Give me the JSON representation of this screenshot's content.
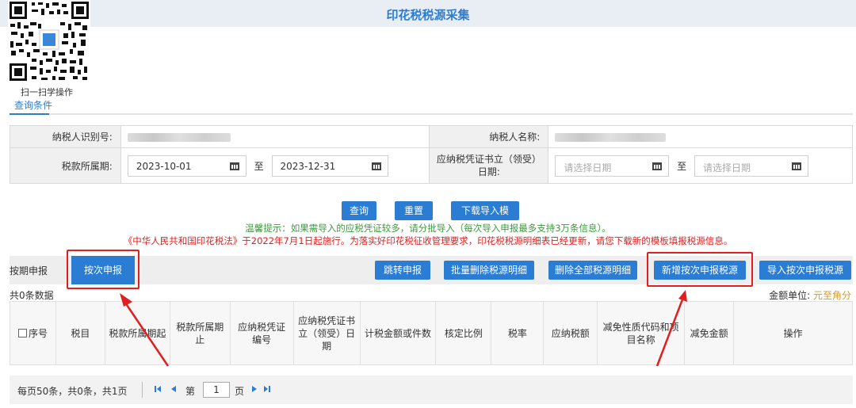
{
  "header": {
    "title": "印花税税源采集"
  },
  "qr": {
    "caption": "扫一扫学操作"
  },
  "query": {
    "section_title": "查询条件",
    "taxpayer_id_label": "纳税人识别号:",
    "taxpayer_name_label": "纳税人名称:",
    "period_label": "税款所属期:",
    "period_from": "2023-10-01",
    "to_label": "至",
    "period_to": "2023-12-31",
    "voucher_date_label": "应纳税凭证书立（领受）日期:",
    "voucher_date_from_placeholder": "请选择日期",
    "voucher_date_to_placeholder": "请选择日期"
  },
  "actions": {
    "query": "查询",
    "reset": "重置",
    "download_template": "下载导入模板"
  },
  "tips": {
    "tip1": "温馨提示：如果需导入的应税凭证较多，请分批导入（每次导入申报最多支持3万条信息）。",
    "tip2": "《中华人民共和国印花税法》于2022年7月1日起施行。为落实好印花税征收管理要求，印花税税源明细表已经更新，请您下载新的模板填报税源信息。"
  },
  "tabs": {
    "periodic": "按期申报",
    "per_time": "按次申报"
  },
  "toolbar": {
    "jump_declare": "跳转申报",
    "batch_delete": "批量删除税源明细",
    "delete_all": "删除全部税源明细",
    "add_per_time": "新增按次申报税源",
    "import_per_time": "导入按次申报税源"
  },
  "summary": {
    "count": "共0条数据",
    "unit_label": "金额单位:",
    "unit_value": "元至角分"
  },
  "columns": [
    "序号",
    "税目",
    "税款所属期起",
    "税款所属期止",
    "应纳税凭证编号",
    "应纳税凭证书立（领受）日期",
    "计税金额或件数",
    "核定比例",
    "税率",
    "应纳税额",
    "减免性质代码和项目名称",
    "减免金额",
    "操作"
  ],
  "pager": {
    "summary": "每页50条，共0条，共1页",
    "page_prefix": "第",
    "page_value": "1",
    "page_suffix": "页"
  },
  "colors": {
    "accent": "#2b7cd3",
    "highlight": "#e02020",
    "tip_green": "#3a9a3a",
    "unit_gold": "#d79a2a"
  }
}
